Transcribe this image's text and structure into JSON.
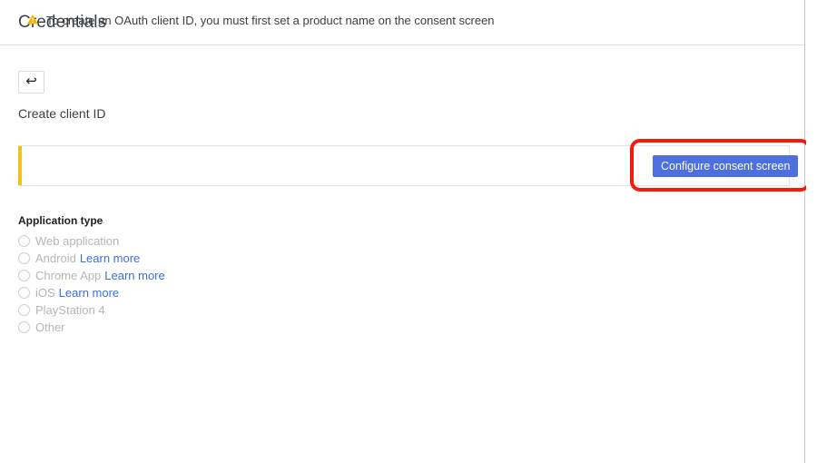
{
  "header": {
    "title": "Credentials"
  },
  "toolbar": {
    "back_button_icon": "back-arrow-icon",
    "back_button_glyph": "↩"
  },
  "page": {
    "subtitle": "Create client ID"
  },
  "banner": {
    "icon": "warning-triangle-icon",
    "message": "To create an OAuth client ID, you must first set a product name on the consent screen",
    "accent_color": "#f5c116",
    "action_label": "Configure consent screen",
    "action_color": "#4d6fe0"
  },
  "annotation": {
    "type": "highlight-rectangle",
    "color": "#f41b0c"
  },
  "application_type": {
    "label": "Application type",
    "options": [
      {
        "label": "Web application",
        "link": ""
      },
      {
        "label": "Android",
        "link": "Learn more"
      },
      {
        "label": "Chrome App",
        "link": "Learn more"
      },
      {
        "label": "iOS",
        "link": "Learn more"
      },
      {
        "label": "PlayStation 4",
        "link": ""
      },
      {
        "label": "Other",
        "link": ""
      }
    ]
  }
}
